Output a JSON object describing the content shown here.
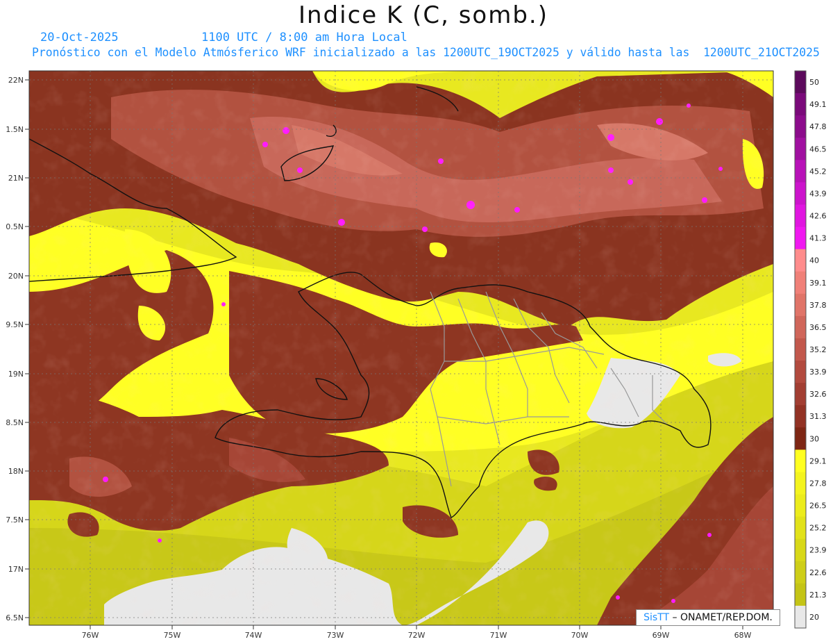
{
  "header": {
    "title": "Indice K (C, somb.)",
    "date": "20-Oct-2025",
    "time": "1100 UTC / 8:00 am Hora Local",
    "forecast": "Pronóstico con el Modelo Atmósferico WRF inicializado a las 1200UTC_19OCT2025 y válido hasta las  1200UTC_21OCT2025"
  },
  "axes": {
    "lat_labels": [
      "22N",
      "1.5N",
      "21N",
      "0.5N",
      "20N",
      "9.5N",
      "19N",
      "8.5N",
      "18N",
      "7.5N",
      "17N",
      "6.5N"
    ],
    "lon_labels": [
      "76W",
      "75W",
      "74W",
      "73W",
      "72W",
      "71W",
      "70W",
      "69W",
      "68W"
    ]
  },
  "colorbar": {
    "labels": [
      "50",
      "49.1",
      "47.8",
      "46.5",
      "45.2",
      "43.9",
      "42.6",
      "41.3",
      "40",
      "39.1",
      "37.8",
      "36.5",
      "35.2",
      "33.9",
      "32.6",
      "31.3",
      "30",
      "29.1",
      "27.8",
      "26.5",
      "25.2",
      "23.9",
      "22.6",
      "21.3",
      "20"
    ],
    "colors": [
      "#5c0a5c",
      "#7a0a7a",
      "#8c0c8c",
      "#a010a0",
      "#b812b8",
      "#cc14cc",
      "#e016e0",
      "#f018f0",
      "#ff8c8c",
      "#f08078",
      "#e07468",
      "#d0665a",
      "#c2584c",
      "#b24a3e",
      "#a23e32",
      "#923224",
      "#7e2614",
      "#ffff20",
      "#f4f41e",
      "#ecec1c",
      "#e2e21a",
      "#d8d818",
      "#cece18",
      "#c4c416",
      "#e8e8e8"
    ]
  },
  "credit": {
    "sis": "SisTT",
    "org": " – ONAMET/REP.DOM."
  }
}
